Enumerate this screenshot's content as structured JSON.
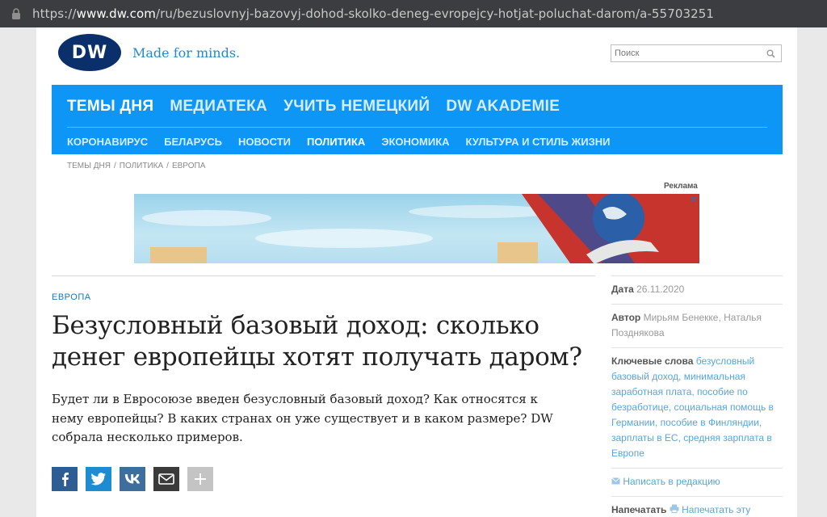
{
  "browser": {
    "url_prefix": "https://",
    "url_host": "www.dw.com",
    "url_path": "/ru/bezuslovnyj-bazovyj-dohod-skolko-deneg-evropejcy-hotjat-poluchat-darom/a-55703251"
  },
  "header": {
    "logo_text": "DW",
    "slogan": "Made for minds.",
    "search_placeholder": "Поиск"
  },
  "nav": {
    "top": [
      {
        "label": "ТЕМЫ ДНЯ",
        "active": true
      },
      {
        "label": "МЕДИАТЕКА",
        "active": false
      },
      {
        "label": "УЧИТЬ НЕМЕЦКИЙ",
        "active": false
      },
      {
        "label": "DW AKADEMIE",
        "active": false
      }
    ],
    "bottom": [
      {
        "label": "КОРОНАВИРУС",
        "active": false
      },
      {
        "label": "БЕЛАРУСЬ",
        "active": false
      },
      {
        "label": "НОВОСТИ",
        "active": false
      },
      {
        "label": "ПОЛИТИКА",
        "active": true
      },
      {
        "label": "ЭКОНОМИКА",
        "active": false
      },
      {
        "label": "КУЛЬТУРА И СТИЛЬ ЖИЗНИ",
        "active": false
      }
    ]
  },
  "breadcrumb": {
    "items": [
      "ТЕМЫ ДНЯ",
      "ПОЛИТИКА",
      "ЕВРОПА"
    ],
    "separator": "/"
  },
  "ad": {
    "label": "Реклама",
    "close": "✕"
  },
  "article": {
    "kicker": "ЕВРОПА",
    "headline": "Безусловный базовый доход: сколько денег европейцы хотят получать даром?",
    "lead": "Будет ли в Евросоюзе введен безусловный базовый доход? Как относятся к нему европейцы? В каких странах он уже существует и в каком размере? DW собрала несколько примеров."
  },
  "share": [
    "facebook-icon",
    "twitter-icon",
    "vk-icon",
    "email-icon",
    "plus-icon"
  ],
  "sidebar": {
    "date_label": "Дата",
    "date_value": "26.11.2020",
    "author_label": "Автор",
    "author_value": "Мирьям Бенекке, Наталья Позднякова",
    "keywords_label": "Ключевые слова",
    "keywords_value": "безусловный базовый доход, минимальная заработная плата, пособие по безработице, социальная помощь в Германии, пособие в Финляндии, зарплаты в ЕС, средняя зарплата в Европе",
    "contact_link": "Написать в редакцию",
    "print_label": "Напечатать",
    "print_link": "Напечатать эту страницу"
  },
  "colors": {
    "nav_bg": "#0e96f6",
    "link": "#1a78c2",
    "logo_bg": "#0a2f6b"
  }
}
